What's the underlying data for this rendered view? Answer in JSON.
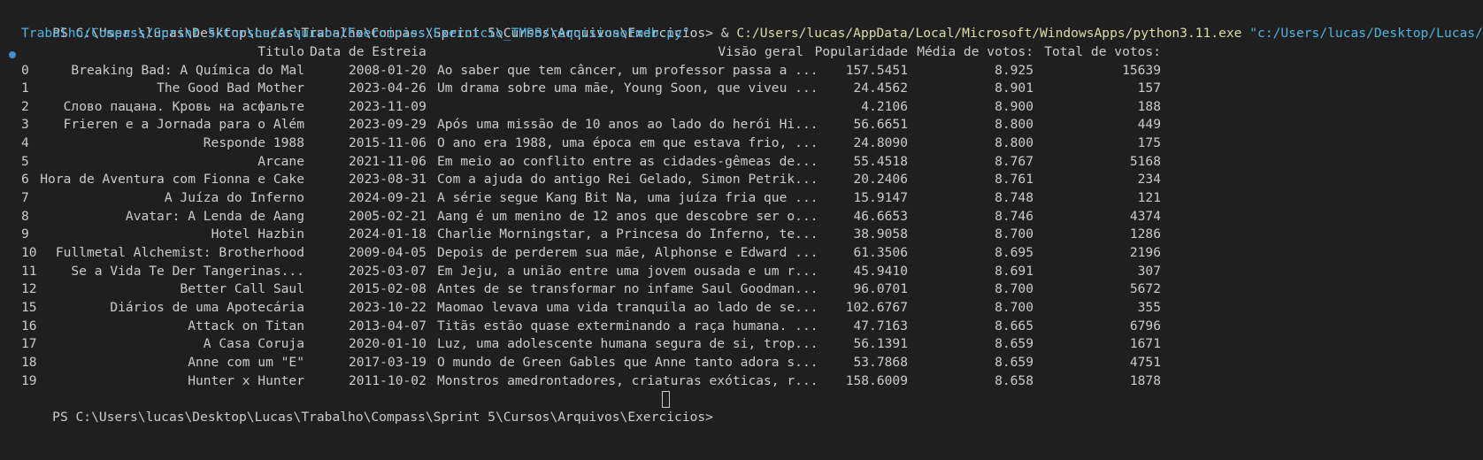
{
  "command": {
    "prompt": "PS C:\\Users\\lucas\\Desktop\\Lucas\\Trabalho\\Compass\\Sprint 5\\Cursos\\Arquivos\\Exercicios> ",
    "operator": "& ",
    "exe": "C:/Users/lucas/AppData/Local/Microsoft/WindowsApps/python3.11.exe",
    "arg_line1": " \"c:/Users/lucas/Desktop/Lucas/",
    "arg_line2": "Trabalho/Compass/Sprint 5/Cursos/Arquivos/Exercicios/Exercicio_TMDB/requisicaotmdb.py\""
  },
  "headers": {
    "title": "Titulo",
    "date": "Data de Estreia",
    "overview": "Visão geral",
    "popularity": "Popularidade",
    "avg": "Média de votos:",
    "total": "Total de votos:"
  },
  "rows": [
    {
      "idx": "0",
      "title": "Breaking Bad: A Química do Mal",
      "date": "2008-01-20",
      "overview": "Ao saber que tem câncer, um professor passa a ...",
      "pop": "157.5451",
      "avg": "8.925",
      "total": "15639"
    },
    {
      "idx": "1",
      "title": "The Good Bad Mother",
      "date": "2023-04-26",
      "overview": "Um drama sobre uma mãe, Young Soon, que viveu ...",
      "pop": "24.4562",
      "avg": "8.901",
      "total": "157"
    },
    {
      "idx": "2",
      "title": "Слово пацана. Кровь на асфальте",
      "date": "2023-11-09",
      "overview": "",
      "pop": "4.2106",
      "avg": "8.900",
      "total": "188"
    },
    {
      "idx": "3",
      "title": "Frieren e a Jornada para o Além",
      "date": "2023-09-29",
      "overview": "Após uma missão de 10 anos ao lado do herói Hi...",
      "pop": "56.6651",
      "avg": "8.800",
      "total": "449"
    },
    {
      "idx": "4",
      "title": "Responde 1988",
      "date": "2015-11-06",
      "overview": "O ano era 1988, uma época em que estava frio, ...",
      "pop": "24.8090",
      "avg": "8.800",
      "total": "175"
    },
    {
      "idx": "5",
      "title": "Arcane",
      "date": "2021-11-06",
      "overview": "Em meio ao conflito entre as cidades-gêmeas de...",
      "pop": "55.4518",
      "avg": "8.767",
      "total": "5168"
    },
    {
      "idx": "6",
      "title": "Hora de Aventura com Fionna e Cake",
      "date": "2023-08-31",
      "overview": "Com a ajuda do antigo Rei Gelado, Simon Petrik...",
      "pop": "20.2406",
      "avg": "8.761",
      "total": "234"
    },
    {
      "idx": "7",
      "title": "A Juíza do Inferno",
      "date": "2024-09-21",
      "overview": "A série segue Kang Bit Na, uma juíza fria que ...",
      "pop": "15.9147",
      "avg": "8.748",
      "total": "121"
    },
    {
      "idx": "8",
      "title": "Avatar: A Lenda de Aang",
      "date": "2005-02-21",
      "overview": "Aang é um menino de 12 anos que descobre ser o...",
      "pop": "46.6653",
      "avg": "8.746",
      "total": "4374"
    },
    {
      "idx": "9",
      "title": "Hotel Hazbin",
      "date": "2024-01-18",
      "overview": "Charlie Morningstar, a Princesa do Inferno, te...",
      "pop": "38.9058",
      "avg": "8.700",
      "total": "1286"
    },
    {
      "idx": "10",
      "title": "Fullmetal Alchemist: Brotherhood",
      "date": "2009-04-05",
      "overview": "Depois de perderem sua mãe, Alphonse e Edward ...",
      "pop": "61.3506",
      "avg": "8.695",
      "total": "2196"
    },
    {
      "idx": "11",
      "title": "Se a Vida Te Der Tangerinas...",
      "date": "2025-03-07",
      "overview": "Em Jeju, a união entre uma jovem ousada e um r...",
      "pop": "45.9410",
      "avg": "8.691",
      "total": "307"
    },
    {
      "idx": "12",
      "title": "Better Call Saul",
      "date": "2015-02-08",
      "overview": "Antes de se transformar no infame Saul Goodman...",
      "pop": "96.0701",
      "avg": "8.700",
      "total": "5672"
    },
    {
      "idx": "15",
      "title": "Diários de uma Apotecária",
      "date": "2023-10-22",
      "overview": "Maomao levava uma vida tranquila ao lado de se...",
      "pop": "102.6767",
      "avg": "8.700",
      "total": "355"
    },
    {
      "idx": "16",
      "title": "Attack on Titan",
      "date": "2013-04-07",
      "overview": "Titãs estão quase exterminando a raça humana. ...",
      "pop": "47.7163",
      "avg": "8.665",
      "total": "6796"
    },
    {
      "idx": "17",
      "title": "A Casa Coruja",
      "date": "2020-01-10",
      "overview": "Luz, uma adolescente humana segura de si, trop...",
      "pop": "56.1391",
      "avg": "8.659",
      "total": "1671"
    },
    {
      "idx": "18",
      "title": "Anne com um \"E\"",
      "date": "2017-03-19",
      "overview": "O mundo de Green Gables que Anne tanto adora s...",
      "pop": "53.7868",
      "avg": "8.659",
      "total": "4751"
    },
    {
      "idx": "19",
      "title": "Hunter x Hunter",
      "date": "2011-10-02",
      "overview": "Monstros amedrontadores, criaturas exóticas, r...",
      "pop": "158.6009",
      "avg": "8.658",
      "total": "1878"
    }
  ],
  "final_prompt": "PS C:\\Users\\lucas\\Desktop\\Lucas\\Trabalho\\Compass\\Sprint 5\\Cursos\\Arquivos\\Exercicios> ",
  "colors": {
    "background": "#1f1f1f",
    "text": "#cccccc",
    "exe": "#dcdcaa",
    "string": "#4fb3e0",
    "marker": "#3c8fd0"
  }
}
